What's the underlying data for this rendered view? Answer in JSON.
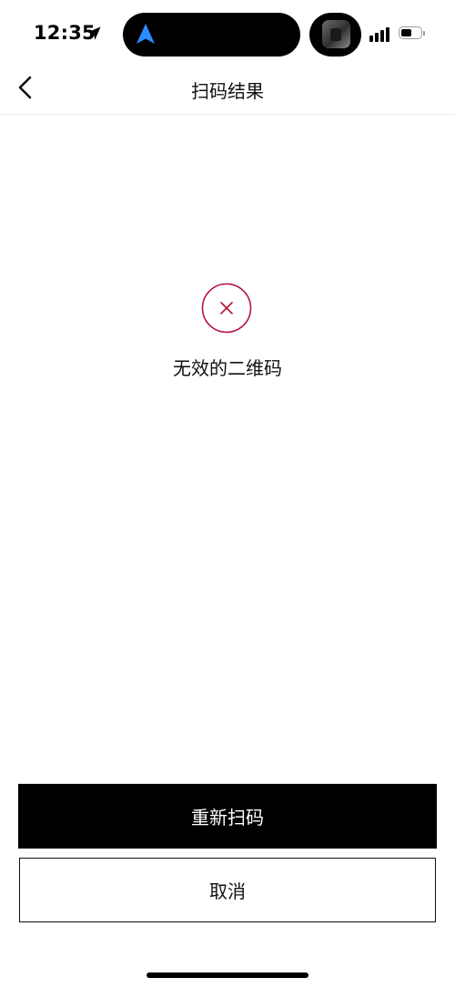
{
  "status_bar": {
    "time": "12:35",
    "location_icon": "location-arrow-icon",
    "navigation_icon": "navigation-arrow-icon",
    "signal_icon": "cellular-signal-icon",
    "battery_icon": "battery-icon",
    "battery_level": 0.55,
    "accent_color": "#2b8cff"
  },
  "nav": {
    "back_icon": "chevron-left-icon",
    "title": "扫码结果"
  },
  "result": {
    "icon": "error-circle-x-icon",
    "icon_color": "#b5133f",
    "message": "无效的二维码"
  },
  "actions": {
    "rescan_label": "重新扫码",
    "cancel_label": "取消"
  }
}
